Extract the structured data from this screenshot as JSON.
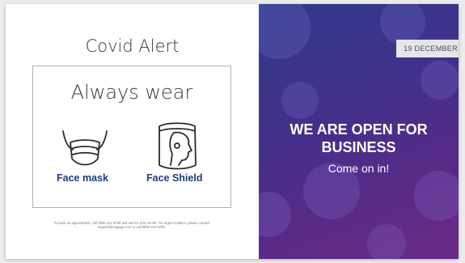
{
  "poster_left": {
    "title": "Covid Alert",
    "heading": "Always wear",
    "items": [
      {
        "label": "Face mask",
        "icon": "face-mask-icon"
      },
      {
        "label": "Face Shield",
        "icon": "face-shield-icon"
      }
    ],
    "footnote": "To book an appointment, call 0892 344 8789 and ask for John Smith. For urgent matters, please contact support@engage.com or call 0892 344 8789."
  },
  "poster_right": {
    "date": "19 DECEMBER",
    "headline": "WE ARE OPEN FOR BUSINESS",
    "subheadline": "Come on in!"
  },
  "colors": {
    "label_blue": "#1f3d7a",
    "right_bg_start": "#2f3b8a",
    "right_bg_end": "#6b2a86"
  }
}
